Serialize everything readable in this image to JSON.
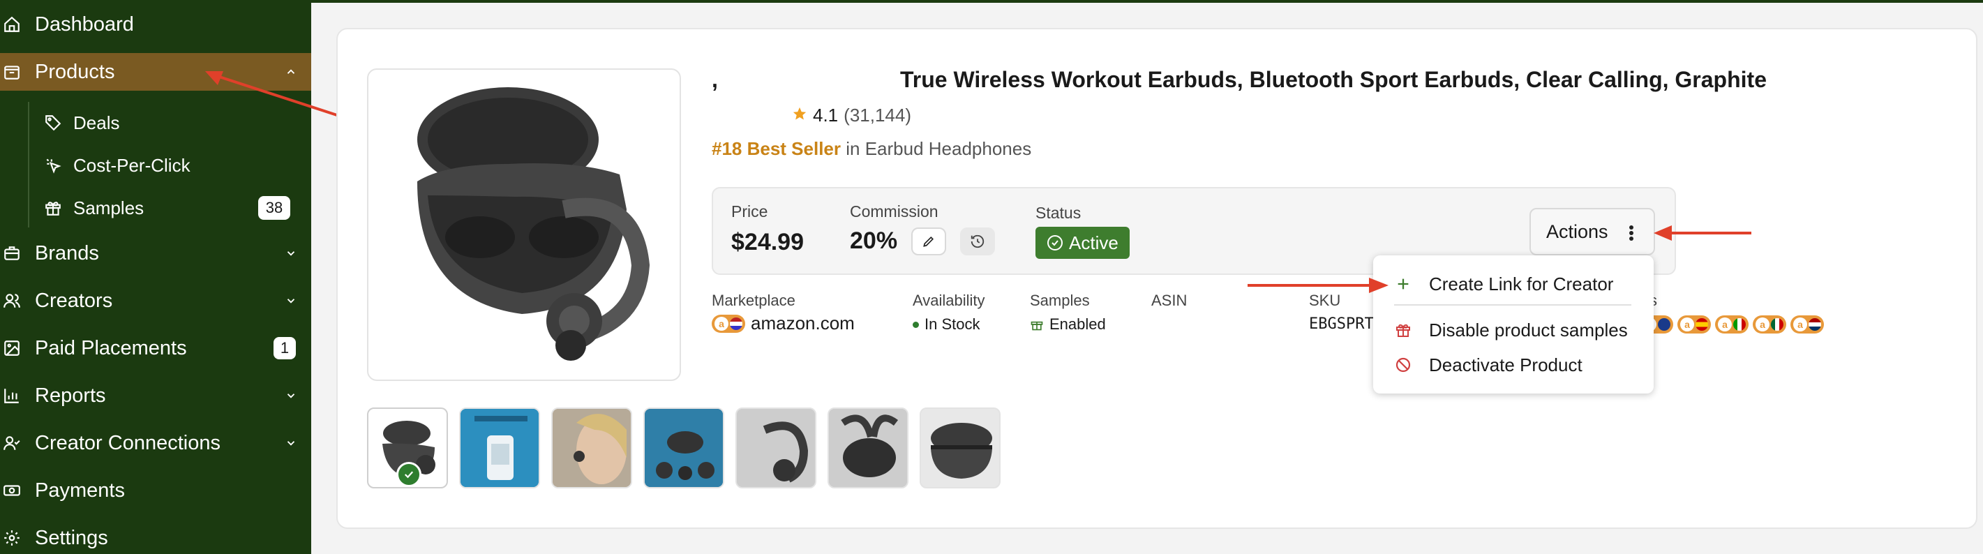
{
  "sidebar": {
    "items": [
      {
        "label": "Dashboard",
        "icon": "home-icon"
      },
      {
        "label": "Products",
        "icon": "package-icon",
        "active": true
      },
      {
        "label": "Brands",
        "icon": "briefcase-icon"
      },
      {
        "label": "Creators",
        "icon": "users-icon"
      },
      {
        "label": "Paid Placements",
        "icon": "image-icon",
        "badge": "1"
      },
      {
        "label": "Reports",
        "icon": "bar-chart-icon"
      },
      {
        "label": "Creator Connections",
        "icon": "user-check-icon"
      },
      {
        "label": "Payments",
        "icon": "cash-icon"
      },
      {
        "label": "Settings",
        "icon": "gear-icon"
      }
    ],
    "sub_items": [
      {
        "label": "Deals",
        "icon": "tag-icon"
      },
      {
        "label": "Cost-Per-Click",
        "icon": "cursor-click-icon"
      },
      {
        "label": "Samples",
        "icon": "gift-icon",
        "badge": "38"
      }
    ]
  },
  "product": {
    "title": "True Wireless Workout Earbuds, Bluetooth Sport Earbuds, Clear Calling, Graphite",
    "title_prefix": ",",
    "rating": "4.1",
    "rating_count": "(31,144)",
    "rank": "#18 Best Seller",
    "rank_category": " in Earbud Headphones"
  },
  "info": {
    "price_label": "Price",
    "price_value": "$24.99",
    "commission_label": "Commission",
    "commission_value": "20%",
    "status_label": "Status",
    "status_value": "Active",
    "actions_label": "Actions"
  },
  "meta": {
    "marketplace_label": "Marketplace",
    "marketplace_value": "amazon.com",
    "availability_label": "Availability",
    "availability_value": "In Stock",
    "samples_label": "Samples",
    "samples_value": "Enabled",
    "asin_label": "ASIN",
    "sku_label": "SKU",
    "sku_value": "EBGSPRT",
    "other_label_partial": "s"
  },
  "dropdown": {
    "items": [
      {
        "label": "Create Link for Creator",
        "icon": "plus-icon"
      },
      {
        "label": "Disable product samples",
        "icon": "gift-icon"
      },
      {
        "label": "Deactivate Product",
        "icon": "ban-icon"
      }
    ]
  },
  "colors": {
    "sidebar_bg": "#1b3a10",
    "active_bg": "#7a5a22",
    "status_green": "#3e7d2e",
    "accent_orange": "#c98316",
    "arrow_red": "#e0402a"
  }
}
